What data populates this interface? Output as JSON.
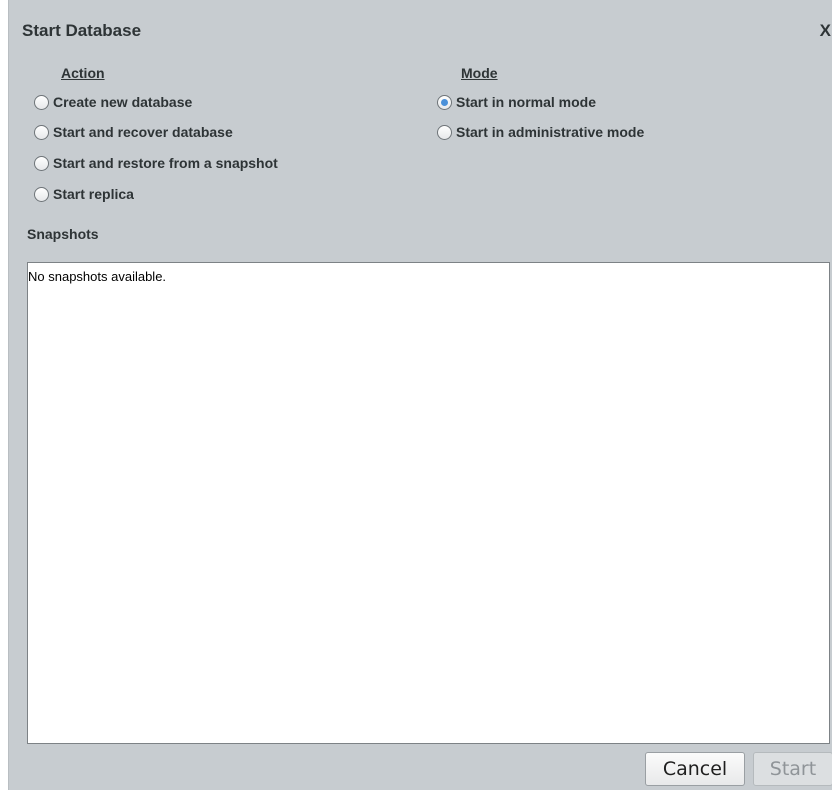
{
  "dialog": {
    "title": "Start Database",
    "close_label": "X"
  },
  "action": {
    "heading": "Action",
    "options": [
      {
        "label": "Create new database",
        "checked": false
      },
      {
        "label": "Start and recover database",
        "checked": false
      },
      {
        "label": "Start and restore from a snapshot",
        "checked": false
      },
      {
        "label": "Start replica",
        "checked": false
      }
    ]
  },
  "mode": {
    "heading": "Mode",
    "options": [
      {
        "label": "Start in normal mode",
        "checked": true
      },
      {
        "label": "Start in administrative mode",
        "checked": false
      }
    ]
  },
  "snapshots": {
    "label": "Snapshots",
    "empty_text": "No snapshots available."
  },
  "buttons": {
    "cancel": "Cancel",
    "start": "Start",
    "start_enabled": false
  },
  "colors": {
    "dialog_bg": "#c7ccd0",
    "radio_dot": "#4a90d9",
    "text": "#2e3436",
    "disabled_text": "#8f9498"
  }
}
